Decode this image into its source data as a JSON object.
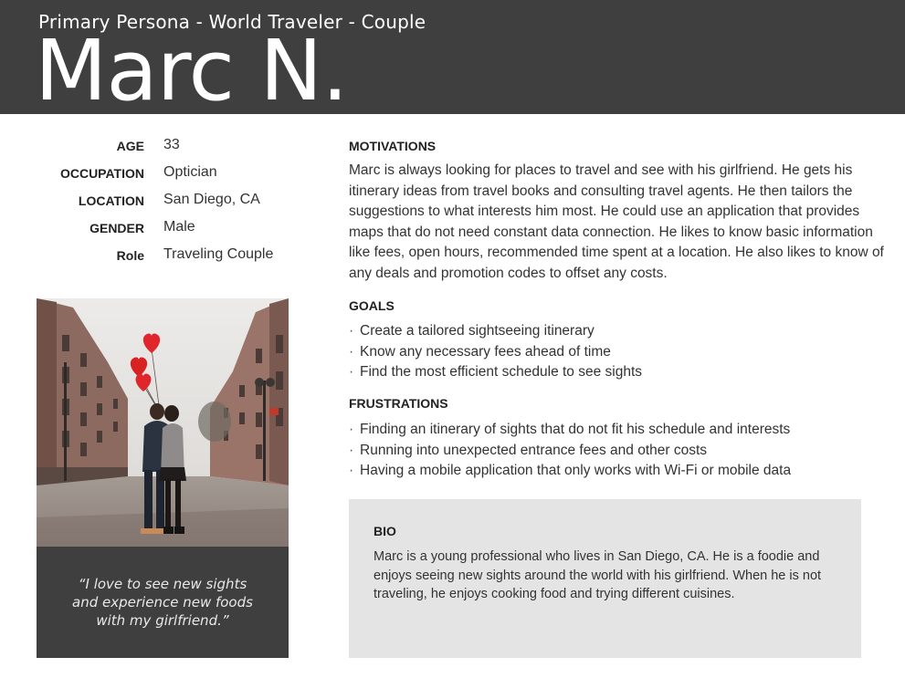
{
  "header": {
    "subtitle": "Primary Persona - World Traveler - Couple",
    "name": "Marc N."
  },
  "details": [
    {
      "label": "AGE",
      "value": "33"
    },
    {
      "label": "OCCUPATION",
      "value": "Optician"
    },
    {
      "label": "LOCATION",
      "value": "San Diego, CA"
    },
    {
      "label": "GENDER",
      "value": "Male"
    },
    {
      "label": "Role",
      "value": "Traveling Couple"
    }
  ],
  "photo": {
    "icon": "couple-street-photo"
  },
  "quote": {
    "line1": "“I love to see new sights",
    "line2": "and experience new foods",
    "line3": "with my girlfriend.”"
  },
  "motivations": {
    "title": "MOTIVATIONS",
    "text": "Marc is always looking for places to travel and see with his girlfriend. He gets his itinerary ideas from travel books and consulting travel agents. He then tailors the suggestions to what interests him most. He could use an application that provides maps that do not need constant data connection. He likes to know basic information like fees, open hours, recommended time spent at a location. He also likes to know of any deals and promotion codes to offset any costs."
  },
  "goals": {
    "title": "GOALS",
    "items": [
      "Create a tailored sightseeing itinerary",
      "Know any necessary fees ahead of time",
      "Find the most efficient schedule to see sights"
    ]
  },
  "frustrations": {
    "title": "FRUSTRATIONS",
    "items": [
      "Finding an itinerary of sights that do not fit his schedule and interests",
      "Running into unexpected entrance fees and other costs",
      "Having a mobile application that only works with Wi-Fi or mobile data"
    ]
  },
  "bio": {
    "title": "BIO",
    "text": "Marc is a young professional who lives in San Diego, CA. He is a foodie and enjoys seeing new sights around the world with his girlfriend. When he is not traveling, he enjoys cooking food and trying different cuisines."
  },
  "colors": {
    "header_bg": "#3f3f40",
    "bio_bg": "#e4e4e4",
    "balloon": "#e0262a"
  }
}
